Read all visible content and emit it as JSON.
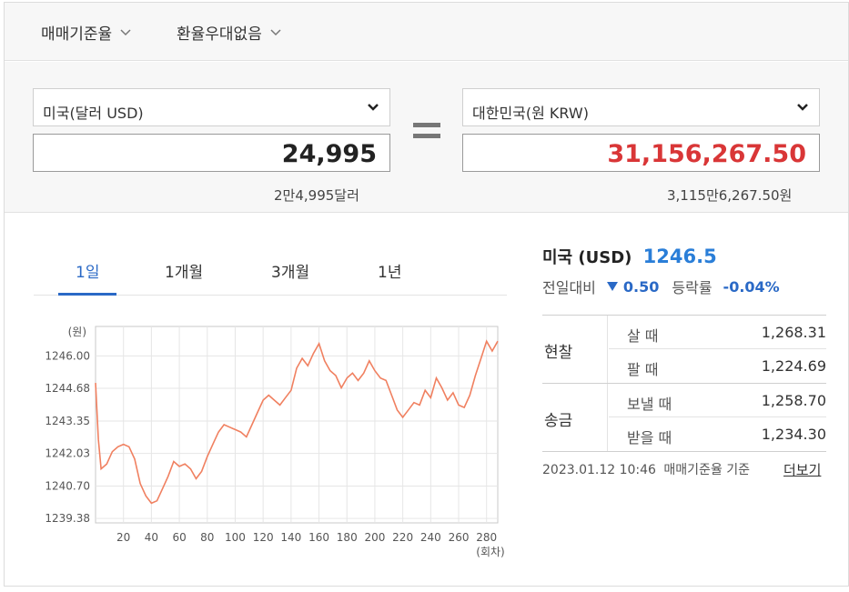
{
  "options": {
    "rate_type": "매매기준율",
    "fx_preference": "환율우대없음"
  },
  "converter": {
    "from_currency": "미국(달러 USD)",
    "from_amount": "24,995",
    "from_reading": "2만4,995달러",
    "to_currency": "대한민국(원 KRW)",
    "to_amount": "31,156,267.50",
    "to_reading": "3,115만6,267.50원",
    "to_amount_color": "#d93637"
  },
  "tabs": [
    {
      "label": "1일",
      "active": true
    },
    {
      "label": "1개월",
      "active": false
    },
    {
      "label": "3개월",
      "active": false
    },
    {
      "label": "1년",
      "active": false
    }
  ],
  "info": {
    "country": "미국",
    "code": "(USD)",
    "rate": "1246.5",
    "change_label": "전일대비",
    "change_value": "0.50",
    "pct_label": "등락률",
    "pct_value": "-0.04%"
  },
  "table": {
    "cash_label": "현찰",
    "cash_buy_label": "살 때",
    "cash_buy_value": "1,268.31",
    "cash_sell_label": "팔 때",
    "cash_sell_value": "1,224.69",
    "remit_label": "송금",
    "remit_send_label": "보낼 때",
    "remit_send_value": "1,258.70",
    "remit_recv_label": "받을 때",
    "remit_recv_value": "1,234.30"
  },
  "footer": {
    "timestamp": "2023.01.12 10:46",
    "basis": "매매기준율 기준",
    "more_link": "더보기"
  },
  "chart_data": {
    "type": "line",
    "ylabel": "(원)",
    "xlabel": "(회차)",
    "yticks": [
      "1246.00",
      "1244.68",
      "1243.35",
      "1242.03",
      "1240.70",
      "1239.38"
    ],
    "ytick_values": [
      1246.0,
      1244.68,
      1243.35,
      1242.03,
      1240.7,
      1239.38
    ],
    "xticks": [
      "20",
      "40",
      "60",
      "80",
      "100",
      "120",
      "140",
      "160",
      "180",
      "200",
      "220",
      "240",
      "260",
      "280"
    ],
    "xtick_values": [
      20,
      40,
      60,
      80,
      100,
      120,
      140,
      160,
      180,
      200,
      220,
      240,
      260,
      280
    ],
    "xlim": [
      0,
      288
    ],
    "ylim": [
      1239.2,
      1247.2
    ],
    "grid": true,
    "line_color": "#f08060",
    "series": [
      {
        "x": [
          0,
          2,
          4,
          8,
          12,
          16,
          20,
          24,
          28,
          32,
          36,
          40,
          44,
          48,
          52,
          56,
          60,
          64,
          68,
          72,
          76,
          80,
          84,
          88,
          92,
          96,
          100,
          104,
          108,
          112,
          116,
          120,
          124,
          128,
          132,
          136,
          140,
          144,
          148,
          152,
          156,
          160,
          164,
          168,
          172,
          176,
          180,
          184,
          188,
          192,
          196,
          200,
          204,
          208,
          212,
          216,
          220,
          224,
          228,
          232,
          236,
          240,
          244,
          248,
          252,
          256,
          260,
          264,
          268,
          272,
          276,
          280,
          284,
          288
        ],
        "y": [
          1244.9,
          1242.6,
          1241.4,
          1241.6,
          1242.1,
          1242.3,
          1242.4,
          1242.3,
          1241.8,
          1240.8,
          1240.3,
          1240.0,
          1240.1,
          1240.6,
          1241.1,
          1241.7,
          1241.5,
          1241.6,
          1241.4,
          1241.0,
          1241.3,
          1241.9,
          1242.4,
          1242.9,
          1243.2,
          1243.1,
          1243.0,
          1242.9,
          1242.7,
          1243.2,
          1243.7,
          1244.2,
          1244.4,
          1244.2,
          1244.0,
          1244.3,
          1244.6,
          1245.5,
          1245.9,
          1245.6,
          1246.1,
          1246.5,
          1245.8,
          1245.4,
          1245.2,
          1244.7,
          1245.1,
          1245.3,
          1245.0,
          1245.3,
          1245.8,
          1245.4,
          1245.1,
          1245.0,
          1244.4,
          1243.8,
          1243.5,
          1243.8,
          1244.1,
          1244.0,
          1244.6,
          1244.3,
          1245.1,
          1244.7,
          1244.2,
          1244.5,
          1244.0,
          1243.9,
          1244.4,
          1245.2,
          1245.9,
          1246.6,
          1246.2,
          1246.6
        ]
      }
    ]
  }
}
